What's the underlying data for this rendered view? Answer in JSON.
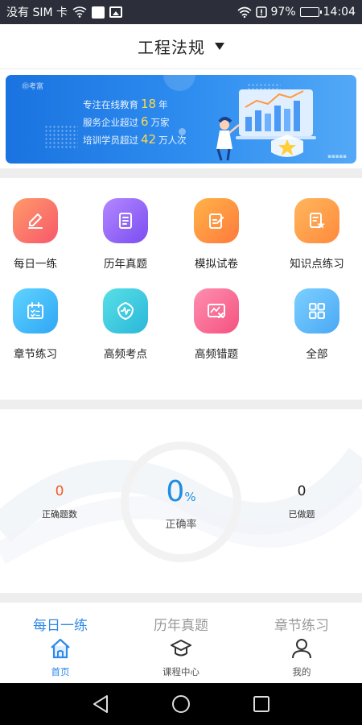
{
  "status_bar": {
    "carrier": "没有 SIM 卡",
    "battery": "97%",
    "battery_level": 0.97,
    "time": "14:04"
  },
  "header": {
    "title": "工程法规"
  },
  "banner": {
    "logo_text": "㊞考富",
    "line1_prefix": "专注在线教育",
    "line1_num": "18",
    "line1_suffix": "年",
    "line2_prefix": "服务企业超过",
    "line2_num": "6",
    "line2_suffix": "万家",
    "line3_prefix": "培训学员超过",
    "line3_num": "42",
    "line3_suffix": "万人次"
  },
  "grid": {
    "items": [
      {
        "label": "每日一练",
        "icon": "pencil-icon",
        "color_from": "#ff9a6a",
        "color_to": "#f7586a"
      },
      {
        "label": "历年真题",
        "icon": "document-icon",
        "color_from": "#b388ff",
        "color_to": "#7b4df2"
      },
      {
        "label": "模拟试卷",
        "icon": "edit-paper-icon",
        "color_from": "#ffb347",
        "color_to": "#ff7a3d"
      },
      {
        "label": "知识点练习",
        "icon": "star-note-icon",
        "color_from": "#ffb65c",
        "color_to": "#ff8a3d"
      },
      {
        "label": "章节练习",
        "icon": "calendar-check-icon",
        "color_from": "#5fd3ff",
        "color_to": "#2fa7f5"
      },
      {
        "label": "高频考点",
        "icon": "pulse-shield-icon",
        "color_from": "#58e0e6",
        "color_to": "#2ab7d9"
      },
      {
        "label": "高频错题",
        "icon": "chart-error-icon",
        "color_from": "#ff8fb0",
        "color_to": "#f4527f"
      },
      {
        "label": "全部",
        "icon": "grid-icon",
        "color_from": "#7cd0ff",
        "color_to": "#4aa8f5"
      }
    ]
  },
  "stats": {
    "correct_count": "0",
    "correct_count_label": "正确题数",
    "rate_value": "0",
    "rate_unit": "%",
    "rate_label": "正确率",
    "done_count": "0",
    "done_count_label": "已做题"
  },
  "tabs": {
    "items": [
      {
        "label": "每日一练",
        "active": true
      },
      {
        "label": "历年真题",
        "active": false
      },
      {
        "label": "章节练习",
        "active": false
      }
    ]
  },
  "bottom_nav": {
    "items": [
      {
        "label": "首页",
        "icon": "home-icon",
        "active": true
      },
      {
        "label": "课程中心",
        "icon": "graduation-cap-icon",
        "active": false
      },
      {
        "label": "我的",
        "icon": "user-icon",
        "active": false
      }
    ]
  },
  "colors": {
    "accent": "#2f8ae8",
    "correct_count": "#f05a28",
    "rate": "#1e8ee0"
  }
}
